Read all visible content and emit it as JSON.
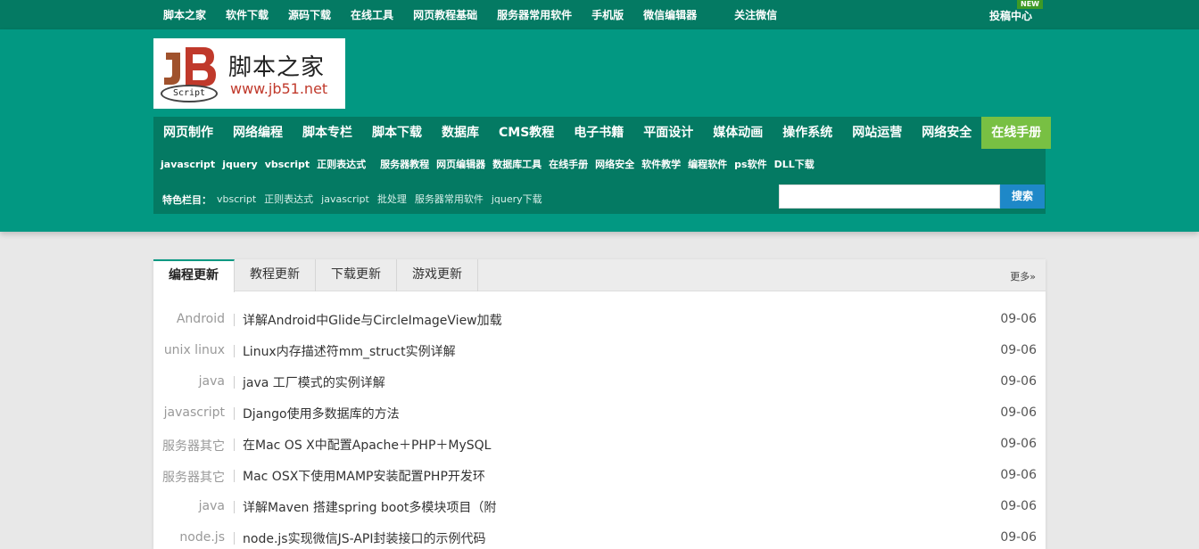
{
  "topbar": {
    "links": [
      "脚本之家",
      "软件下载",
      "源码下载",
      "在线工具",
      "网页教程基础",
      "服务器常用软件",
      "手机版",
      "微信编辑器",
      "关注微信"
    ],
    "submit": "投稿中心",
    "badge": "NEW"
  },
  "logo": {
    "mark_text": "JB",
    "script_text": "Script",
    "name": "脚本之家",
    "url": "www.jb51.net"
  },
  "mainnav": [
    "网页制作",
    "网络编程",
    "脚本专栏",
    "脚本下载",
    "数据库",
    "CMS教程",
    "电子书籍",
    "平面设计",
    "媒体动画",
    "操作系统",
    "网站运营",
    "网络安全"
  ],
  "mainnav_active": "在线手册",
  "subnav": {
    "row1_a": [
      "javascript",
      "jquery",
      "vbscript",
      "正则表达式"
    ],
    "row1_b": [
      "服务器教程",
      "网页编辑器",
      "数据库工具",
      "在线手册",
      "网络安全",
      "软件教学",
      "编程软件",
      "ps软件",
      "DLL下载"
    ],
    "featured_label": "特色栏目：",
    "featured": [
      "vbscript",
      "正则表达式",
      "javascript",
      "批处理",
      "服务器常用软件",
      "jquery下载"
    ]
  },
  "search": {
    "placeholder": "",
    "button": "搜索"
  },
  "tabs": [
    "编程更新",
    "教程更新",
    "下载更新",
    "游戏更新"
  ],
  "more": "更多»",
  "articles": [
    {
      "category": "Android",
      "title": "详解Android中Glide与CircleImageView加载",
      "date": "09-06"
    },
    {
      "category": "unix linux",
      "title": "Linux内存描述符mm_struct实例详解",
      "date": "09-06"
    },
    {
      "category": "java",
      "title": "java 工厂模式的实例详解",
      "date": "09-06"
    },
    {
      "category": "javascript",
      "title": "Django使用多数据库的方法",
      "date": "09-06"
    },
    {
      "category": "服务器其它",
      "title": "在Mac OS X中配置Apache＋PHP＋MySQL",
      "date": "09-06"
    },
    {
      "category": "服务器其它",
      "title": "Mac OSX下使用MAMP安装配置PHP开发环",
      "date": "09-06"
    },
    {
      "category": "java",
      "title": "详解Maven 搭建spring boot多模块项目（附",
      "date": "09-06"
    },
    {
      "category": "node.js",
      "title": "node.js实现微信JS-API封装接口的示例代码",
      "date": "09-06"
    }
  ],
  "colors": {
    "topbar": "#047a63",
    "header": "#029882",
    "active_nav": "#78c043",
    "search_button": "#1e88c8"
  }
}
